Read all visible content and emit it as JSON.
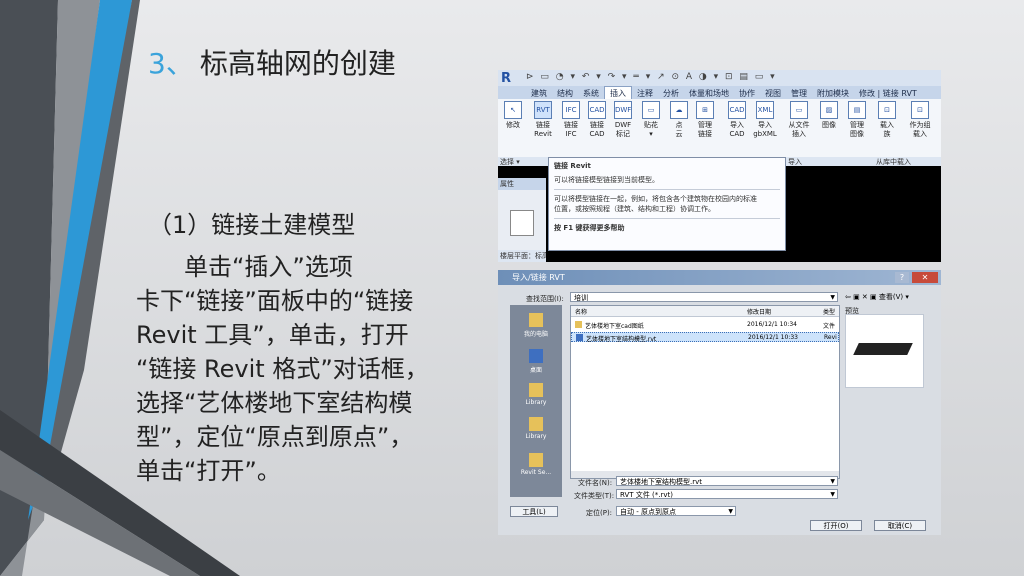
{
  "slide": {
    "title_number": "3、",
    "title_text": "标高轴网的创建",
    "subtitle": "（1）链接土建模型",
    "body_lines": [
      "　　单击“插入”选项",
      "卡下“链接”面板中的“链接",
      "Revit 工具”，单击，打开",
      "“链接 Revit 格式”对话框，",
      "选择“艺体楼地下室结构模",
      "型”，定位“原点到原点”，",
      "单击“打开”。"
    ],
    "accent_color": "#3aa3db"
  },
  "ribbon": {
    "app_logo": "R",
    "qat_icons_text": "⊳ ▭ ◔ ▾ ↶ ▾ ↷ ▾ ═ ▾ ↗ ⊙ A ◑ ▾ ⊡ ▤ ▭ ▾",
    "tabs": [
      "建筑",
      "结构",
      "系统",
      "插入",
      "注释",
      "分析",
      "体量和场地",
      "协作",
      "视图",
      "管理",
      "附加模块",
      "修改 | 链接 RVT"
    ],
    "active_tab": "插入",
    "buttons": [
      {
        "icon": "↖",
        "label": "修改"
      },
      {
        "icon": "RVT",
        "label": "链接\nRevit"
      },
      {
        "icon": "IFC",
        "label": "链接\nIFC"
      },
      {
        "icon": "CAD",
        "label": "链接\nCAD"
      },
      {
        "icon": "DWF",
        "label": "DWF\n标记"
      },
      {
        "icon": "▭",
        "label": "贴花\n▾"
      },
      {
        "icon": "☁",
        "label": "点\n云"
      },
      {
        "icon": "⊞",
        "label": "管理\n链接"
      },
      {
        "icon": "CAD",
        "label": "导入\nCAD"
      },
      {
        "icon": "XML",
        "label": "导入\ngbXML"
      },
      {
        "icon": "▭",
        "label": "从文件\n插入"
      },
      {
        "icon": "▨",
        "label": "图像"
      },
      {
        "icon": "▤",
        "label": "管理\n图像"
      },
      {
        "icon": "⊡",
        "label": "载入\n族"
      },
      {
        "icon": "⊡",
        "label": "作为组\n载入"
      }
    ],
    "group_labels": [
      "选择 ▾",
      "链接",
      "导入",
      "从库中载入"
    ],
    "tooltip": {
      "title": "链接 Revit",
      "line1": "可以将链接模型链接到当前模型。",
      "line2": "可以将模型链接在一起，例如，将包含各个建筑物在校园内的标准",
      "line3": "位置，或按照规程（建筑、结构和工程）协调工作。",
      "help": "按 F1 键获得更多帮助"
    },
    "properties": {
      "header": "属性",
      "footer": "楼层平面：标高 1"
    }
  },
  "dialog": {
    "title": "导入/链接 RVT",
    "help_btn": "?",
    "close_btn": "✕",
    "lookin_label": "查找范围(I):",
    "lookin_value": "培训",
    "tool_icons": "⇦ ▣ ✕ ▣ 查看(V) ▾",
    "preview_label": "预览",
    "columns": [
      "名称",
      "修改日期",
      "类型"
    ],
    "files": [
      {
        "name": "艺体楼地下室cad图纸",
        "date": "2016/12/1 10:34",
        "type": "文件",
        "kind": "folder"
      },
      {
        "name": "艺体楼地下室结构模型.rvt",
        "date": "2016/12/1 10:33",
        "type": "Revi",
        "kind": "rvt"
      }
    ],
    "places": [
      "我的电脑",
      "桌面",
      "Library",
      "Library",
      "Revit Se..."
    ],
    "filename_label": "文件名(N):",
    "filename_value": "艺体楼地下室结构模型.rvt",
    "filetype_label": "文件类型(T):",
    "filetype_value": "RVT 文件 (*.rvt)",
    "position_label": "定位(P):",
    "position_value": "自动 - 原点到原点",
    "tools_button": "工具(L)",
    "open_button": "打开(O)",
    "cancel_button": "取消(C)"
  }
}
